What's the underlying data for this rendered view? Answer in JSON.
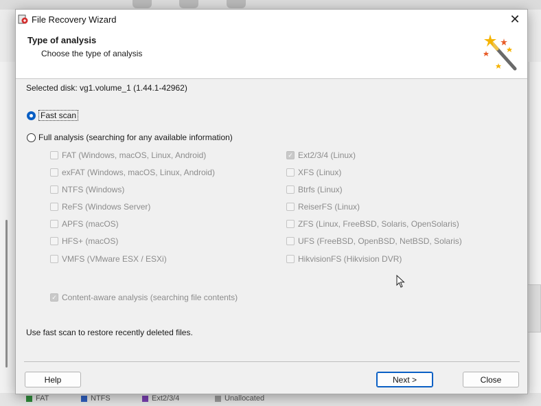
{
  "window": {
    "title": "File Recovery Wizard",
    "close_glyph": "✕",
    "app_icon": "file-recovery-app-icon"
  },
  "header": {
    "title": "Type of analysis",
    "subtitle": "Choose the type of analysis",
    "icon": "magic-wand-icon"
  },
  "selected_disk": "Selected disk: vg1.volume_1 (1.44.1-42962)",
  "scan_options": {
    "fast_scan": {
      "label": "Fast scan",
      "selected": true
    },
    "full_analysis": {
      "label": "Full analysis (searching for any available information)",
      "selected": false
    }
  },
  "filesystems_left": [
    {
      "label": "FAT (Windows, macOS, Linux, Android)",
      "checked": false
    },
    {
      "label": "exFAT (Windows, macOS, Linux, Android)",
      "checked": false
    },
    {
      "label": "NTFS (Windows)",
      "checked": false
    },
    {
      "label": "ReFS (Windows Server)",
      "checked": false
    },
    {
      "label": "APFS (macOS)",
      "checked": false
    },
    {
      "label": "HFS+ (macOS)",
      "checked": false
    },
    {
      "label": "VMFS (VMware ESX / ESXi)",
      "checked": false
    }
  ],
  "filesystems_right": [
    {
      "label": "Ext2/3/4 (Linux)",
      "checked": true
    },
    {
      "label": "XFS (Linux)",
      "checked": false
    },
    {
      "label": "Btrfs (Linux)",
      "checked": false
    },
    {
      "label": "ReiserFS (Linux)",
      "checked": false
    },
    {
      "label": "ZFS (Linux, FreeBSD, Solaris, OpenSolaris)",
      "checked": false
    },
    {
      "label": "UFS (FreeBSD, OpenBSD, NetBSD, Solaris)",
      "checked": false
    },
    {
      "label": "HikvisionFS (Hikvision DVR)",
      "checked": false
    }
  ],
  "content_aware": {
    "label": "Content-aware analysis (searching file contents)",
    "checked": true
  },
  "hint": "Use fast scan to restore recently deleted files.",
  "buttons": {
    "help": "Help",
    "next": "Next >",
    "close": "Close"
  },
  "background_legend": [
    {
      "label": "FAT",
      "color": "#2e8b3a"
    },
    {
      "label": "NTFS",
      "color": "#2f5fbf"
    },
    {
      "label": "Ext2/3/4",
      "color": "#7a3fb0"
    },
    {
      "label": "Unallocated",
      "color": "#9a9a9a"
    }
  ],
  "colors": {
    "accent": "#0a5fc4",
    "disabled_text": "#8c8c8c"
  }
}
